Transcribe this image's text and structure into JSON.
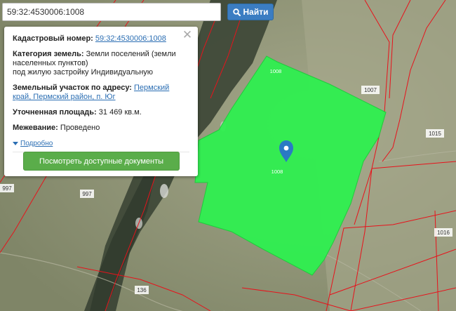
{
  "search": {
    "value": "59:32:4530006:1008",
    "button_label": "Найти"
  },
  "popup": {
    "cadastral_number_label": "Кадастровый номер:",
    "cadastral_number": "59:32:4530006:1008",
    "category_label": "Категория земель:",
    "category_value": "Земли поселений (земли населенных пунктов)",
    "permitted_use": "под жилую застройку Индивидуальную",
    "address_label": "Земельный участок по адресу:",
    "address_value": "Пермский край, Пермский район, п. Юг",
    "area_label": "Уточненная площадь:",
    "area_value": "31 469 кв.м.",
    "survey_label": "Межевание:",
    "survey_value": "Проведено",
    "more_label": "Подробно",
    "docs_button_label": "Посмотреть доступные документы"
  },
  "map": {
    "labels": {
      "parcel_top": "1008",
      "parcel_center": "1008",
      "p1007": "1007",
      "p1015": "1015",
      "p1016": "1016",
      "p997_left": "997",
      "p997_right": "997",
      "p136": "136"
    },
    "colors": {
      "parcel_fill": "#2ff050",
      "boundary": "#e8121b",
      "marker": "#2a7ac4"
    }
  }
}
